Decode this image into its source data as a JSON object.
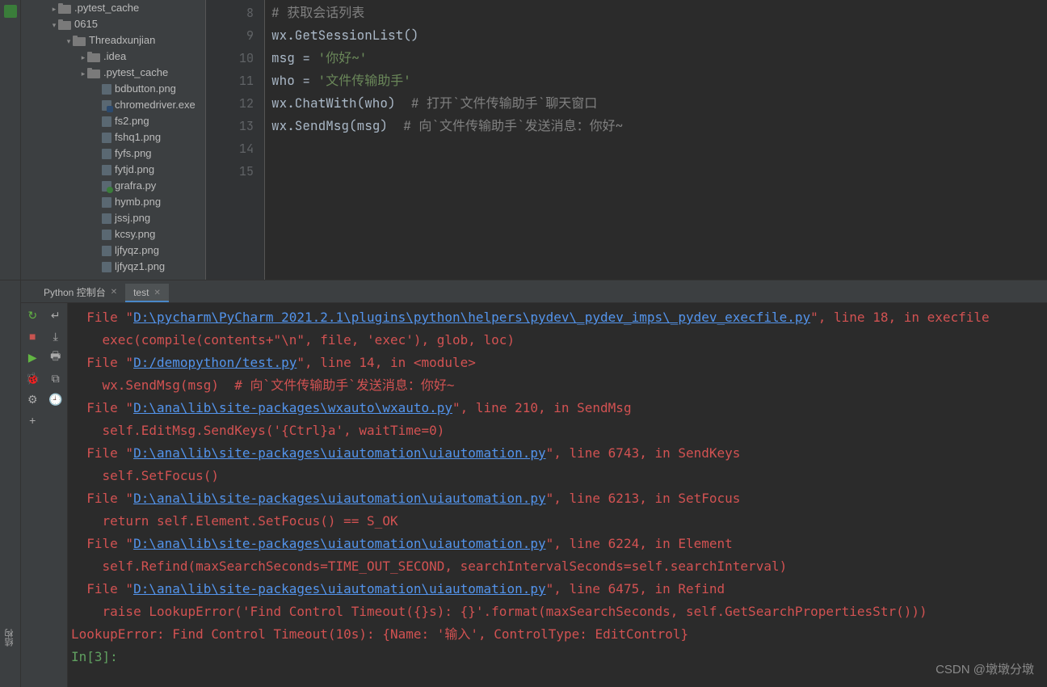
{
  "tree": {
    "items": [
      {
        "depth": 2,
        "chev": ">",
        "icon": "folder",
        "label": ".pytest_cache"
      },
      {
        "depth": 2,
        "chev": "v",
        "icon": "folder",
        "label": "0615"
      },
      {
        "depth": 3,
        "chev": "v",
        "icon": "folder",
        "label": "Threadxunjian"
      },
      {
        "depth": 4,
        "chev": ">",
        "icon": "folder",
        "label": ".idea"
      },
      {
        "depth": 4,
        "chev": ">",
        "icon": "folder",
        "label": ".pytest_cache"
      },
      {
        "depth": 5,
        "chev": "",
        "icon": "file",
        "label": "bdbutton.png"
      },
      {
        "depth": 5,
        "chev": "",
        "icon": "exe",
        "label": "chromedriver.exe"
      },
      {
        "depth": 5,
        "chev": "",
        "icon": "file",
        "label": "fs2.png"
      },
      {
        "depth": 5,
        "chev": "",
        "icon": "file",
        "label": "fshq1.png"
      },
      {
        "depth": 5,
        "chev": "",
        "icon": "file",
        "label": "fyfs.png"
      },
      {
        "depth": 5,
        "chev": "",
        "icon": "file",
        "label": "fytjd.png"
      },
      {
        "depth": 5,
        "chev": "",
        "icon": "py",
        "label": "grafra.py"
      },
      {
        "depth": 5,
        "chev": "",
        "icon": "file",
        "label": "hymb.png"
      },
      {
        "depth": 5,
        "chev": "",
        "icon": "file",
        "label": "jssj.png"
      },
      {
        "depth": 5,
        "chev": "",
        "icon": "file",
        "label": "kcsy.png"
      },
      {
        "depth": 5,
        "chev": "",
        "icon": "file",
        "label": "ljfyqz.png"
      },
      {
        "depth": 5,
        "chev": "",
        "icon": "file",
        "label": "ljfyqz1.png"
      }
    ]
  },
  "editor": {
    "line_start": 8,
    "lines": [
      {
        "segments": [
          {
            "c": "cm",
            "t": "# 获取会话列表"
          }
        ]
      },
      {
        "segments": [
          {
            "c": "fn",
            "t": "wx.GetSessionList()"
          }
        ]
      },
      {
        "segments": [
          {
            "c": "fn",
            "t": ""
          }
        ]
      },
      {
        "segments": [
          {
            "c": "fn",
            "t": "msg = "
          },
          {
            "c": "str",
            "t": "'你好~'"
          }
        ]
      },
      {
        "segments": [
          {
            "c": "fn",
            "t": "who = "
          },
          {
            "c": "str",
            "t": "'文件传输助手'"
          }
        ]
      },
      {
        "segments": [
          {
            "c": "fn",
            "t": "wx.ChatWith(who)  "
          },
          {
            "c": "cm",
            "t": "# 打开`文件传输助手`聊天窗口"
          }
        ]
      },
      {
        "segments": [
          {
            "c": "fn",
            "t": "wx.SendMsg(msg)  "
          },
          {
            "c": "cm",
            "t": "# 向`文件传输助手`发送消息：你好~"
          }
        ]
      },
      {
        "segments": [
          {
            "c": "fn",
            "t": ""
          }
        ]
      }
    ]
  },
  "tabs": {
    "console_tab": "Python 控制台",
    "test_tab": "test"
  },
  "sidebar_label": "结构",
  "console": {
    "lines": [
      [
        {
          "c": "err",
          "t": "  File \""
        },
        {
          "c": "lnk",
          "t": "D:\\pycharm\\PyCharm 2021.2.1\\plugins\\python\\helpers\\pydev\\_pydev_imps\\_pydev_execfile.py"
        },
        {
          "c": "err",
          "t": "\", line 18, in execfile"
        }
      ],
      [
        {
          "c": "err",
          "t": "    exec(compile(contents+\"\\n\", file, 'exec'), glob, loc)"
        }
      ],
      [
        {
          "c": "err",
          "t": "  File \""
        },
        {
          "c": "lnk",
          "t": "D:/demopython/test.py"
        },
        {
          "c": "err",
          "t": "\", line 14, in <module>"
        }
      ],
      [
        {
          "c": "err",
          "t": "    wx.SendMsg(msg)  # 向`文件传输助手`发送消息：你好~"
        }
      ],
      [
        {
          "c": "err",
          "t": "  File \""
        },
        {
          "c": "lnk",
          "t": "D:\\ana\\lib\\site-packages\\wxauto\\wxauto.py"
        },
        {
          "c": "err",
          "t": "\", line 210, in SendMsg"
        }
      ],
      [
        {
          "c": "err",
          "t": "    self.EditMsg.SendKeys('{Ctrl}a', waitTime=0)"
        }
      ],
      [
        {
          "c": "err",
          "t": "  File \""
        },
        {
          "c": "lnk",
          "t": "D:\\ana\\lib\\site-packages\\uiautomation\\uiautomation.py"
        },
        {
          "c": "err",
          "t": "\", line 6743, in SendKeys"
        }
      ],
      [
        {
          "c": "err",
          "t": "    self.SetFocus()"
        }
      ],
      [
        {
          "c": "err",
          "t": "  File \""
        },
        {
          "c": "lnk",
          "t": "D:\\ana\\lib\\site-packages\\uiautomation\\uiautomation.py"
        },
        {
          "c": "err",
          "t": "\", line 6213, in SetFocus"
        }
      ],
      [
        {
          "c": "err",
          "t": "    return self.Element.SetFocus() == S_OK"
        }
      ],
      [
        {
          "c": "err",
          "t": "  File \""
        },
        {
          "c": "lnk",
          "t": "D:\\ana\\lib\\site-packages\\uiautomation\\uiautomation.py"
        },
        {
          "c": "err",
          "t": "\", line 6224, in Element"
        }
      ],
      [
        {
          "c": "err",
          "t": "    self.Refind(maxSearchSeconds=TIME_OUT_SECOND, searchIntervalSeconds=self.searchInterval)"
        }
      ],
      [
        {
          "c": "err",
          "t": "  File \""
        },
        {
          "c": "lnk",
          "t": "D:\\ana\\lib\\site-packages\\uiautomation\\uiautomation.py"
        },
        {
          "c": "err",
          "t": "\", line 6475, in Refind"
        }
      ],
      [
        {
          "c": "err",
          "t": "    raise LookupError('Find Control Timeout({}s): {}'.format(maxSearchSeconds, self.GetSearchPropertiesStr()))"
        }
      ],
      [
        {
          "c": "err",
          "t": "LookupError: Find Control Timeout(10s): {Name: '输入', ControlType: EditControl}"
        }
      ],
      [
        {
          "c": "fn",
          "t": ""
        }
      ],
      [
        {
          "c": "prm",
          "t": "In[3]:"
        }
      ]
    ]
  },
  "watermark": "CSDN @墩墩分墩"
}
